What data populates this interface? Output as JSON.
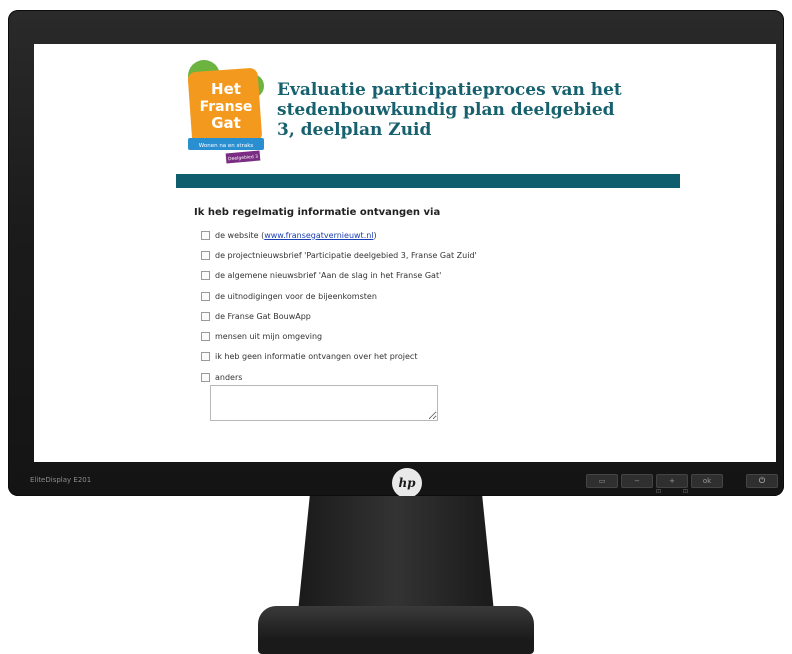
{
  "monitor": {
    "model_label": "EliteDisplay E201",
    "brand": "hp",
    "controls": [
      "▭",
      "−",
      "+",
      "ok"
    ],
    "control_sub": [
      "⊡",
      "⊡"
    ],
    "power_symbol": "⏻"
  },
  "logo": {
    "line1": "Het",
    "line2": "Franse",
    "line3": "Gat",
    "tagline": "Wonen na en straks",
    "tag": "Deelgebied 3",
    "colors": {
      "orange": "#f39a1e",
      "green": "#6cb33f",
      "blue": "#2a8fd0",
      "purple": "#7a2e83"
    }
  },
  "page": {
    "title": "Evaluatie participatieproces van het stedenbouwkundig plan deelgebied 3, deelplan Zuid",
    "accent_color": "#0f5e6d"
  },
  "form": {
    "question": "Ik heb regelmatig informatie ontvangen via",
    "options": [
      {
        "label": "de website (",
        "link": "www.fransegatvernieuwt.nl",
        "suffix": ")",
        "checked": false
      },
      {
        "label": "de projectnieuwsbrief 'Participatie deelgebied 3, Franse Gat Zuid'",
        "checked": false
      },
      {
        "label": "de algemene nieuwsbrief 'Aan de slag in het Franse Gat'",
        "checked": false
      },
      {
        "label": "de uitnodigingen voor de bijeenkomsten",
        "checked": false
      },
      {
        "label": "de Franse Gat BouwApp",
        "checked": false
      },
      {
        "label": "mensen uit mijn omgeving",
        "checked": false
      },
      {
        "label": "ik heb geen informatie ontvangen over het project",
        "checked": false
      },
      {
        "label": "anders",
        "checked": false
      }
    ],
    "other_value": ""
  }
}
